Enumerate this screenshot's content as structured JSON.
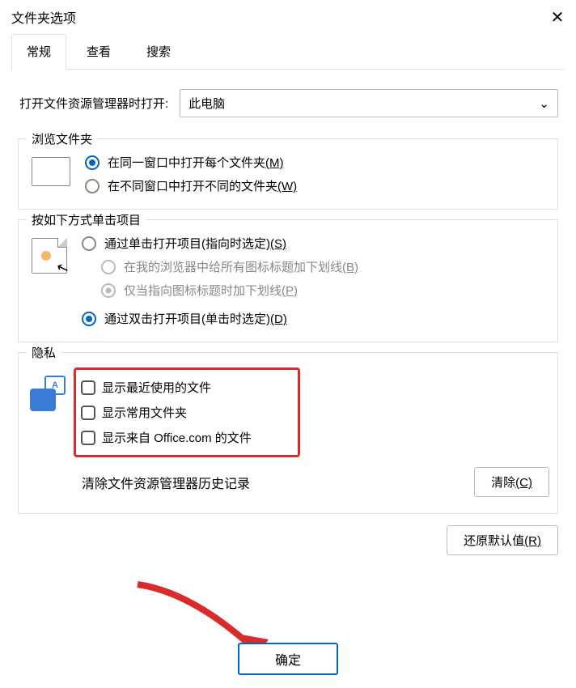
{
  "title": "文件夹选项",
  "tabs": {
    "general": "常规",
    "view": "查看",
    "search": "搜索"
  },
  "open_label": "打开文件资源管理器时打开:",
  "open_select": {
    "value": "此电脑"
  },
  "browse": {
    "legend": "浏览文件夹",
    "opt_same": "在同一窗口中打开每个文件夹",
    "opt_same_key": "(M)",
    "opt_new": "在不同窗口中打开不同的文件夹",
    "opt_new_key": "(W)"
  },
  "click": {
    "legend": "按如下方式单击项目",
    "single": "通过单击打开项目(指向时选定)",
    "single_key": "(S)",
    "ul_browser": "在我的浏览器中给所有图标标题加下划线",
    "ul_browser_key": "(B)",
    "ul_point": "仅当指向图标标题时加下划线",
    "ul_point_key": "(P)",
    "double": "通过双击打开项目(单击时选定)",
    "double_key": "(D)"
  },
  "privacy": {
    "legend": "隐私",
    "recent": "显示最近使用的文件",
    "frequent": "显示常用文件夹",
    "office": "显示来自 Office.com 的文件",
    "clear_text": "清除文件资源管理器历史记录",
    "clear_btn": "清除",
    "clear_key": "(C)"
  },
  "restore": {
    "label": "还原默认值",
    "key": "(R)"
  },
  "ok": "确定"
}
